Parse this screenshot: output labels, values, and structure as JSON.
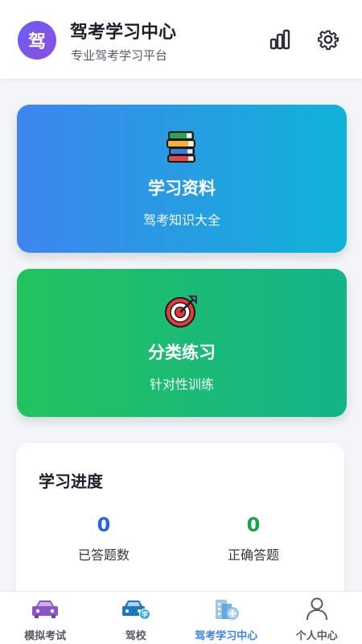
{
  "header": {
    "logo_char": "驾",
    "title": "驾考学习中心",
    "subtitle": "专业驾考学习平台",
    "icons": [
      "bar-chart-icon",
      "gear-icon"
    ]
  },
  "cards": [
    {
      "title": "学习资料",
      "subtitle": "驾考知识大全",
      "icon": "books-icon",
      "colors": [
        "#3f85ee",
        "#0fb3d8"
      ]
    },
    {
      "title": "分类练习",
      "subtitle": "针对性训练",
      "icon": "target-icon",
      "colors": [
        "#22c35e",
        "#14b38a"
      ]
    }
  ],
  "progress": {
    "title": "学习进度",
    "stats": [
      {
        "value": "0",
        "label": "已答题数",
        "color": "#2563eb"
      },
      {
        "value": "0",
        "label": "正确答题",
        "color": "#16a34a"
      }
    ]
  },
  "tabbar": {
    "tabs": [
      {
        "label": "模拟考试",
        "icon": "car-icon",
        "active": false
      },
      {
        "label": "驾校",
        "icon": "school-car-icon",
        "active": false
      },
      {
        "label": "驾考学习中心",
        "icon": "building-icon",
        "active": true
      },
      {
        "label": "个人中心",
        "icon": "user-icon",
        "active": false
      }
    ],
    "active_color": "#3b82f6"
  }
}
